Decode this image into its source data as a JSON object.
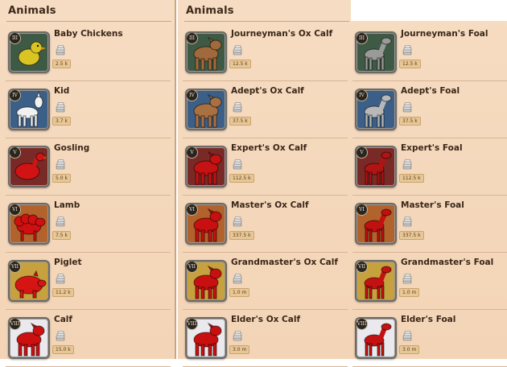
{
  "panels": [
    {
      "title": "Animals"
    },
    {
      "title": "Animals"
    }
  ],
  "left_items": [
    {
      "tier": "III",
      "name": "Baby Chickens",
      "price": "2.5 k",
      "icon": "chicken-icon",
      "bg": "#3f5a44",
      "animal": "#d9c423"
    },
    {
      "tier": "IV",
      "name": "Kid",
      "price": "3.7 k",
      "icon": "goat-kid-icon",
      "bg": "#3b5f86",
      "animal": "#f1f1f1"
    },
    {
      "tier": "V",
      "name": "Gosling",
      "price": "5.0 k",
      "icon": "gosling-icon",
      "bg": "#7a2a26",
      "animal": "#d21313"
    },
    {
      "tier": "VI",
      "name": "Lamb",
      "price": "7.5 k",
      "icon": "lamb-icon",
      "bg": "#b2622b",
      "animal": "#d01010"
    },
    {
      "tier": "VII",
      "name": "Piglet",
      "price": "11.2 k",
      "icon": "piglet-icon",
      "bg": "#c7a13d",
      "animal": "#d61414"
    },
    {
      "tier": "VIII",
      "name": "Calf",
      "price": "15.0 k",
      "icon": "calf-icon",
      "bg": "#e9e9ee",
      "animal": "#cc1010"
    }
  ],
  "right_items": [
    {
      "tier": "III",
      "name": "Journeyman's Ox Calf",
      "price": "12.5 k",
      "icon": "ox-calf-icon",
      "bg": "#3f5a44",
      "animal": "#a06a3c"
    },
    {
      "tier": "III",
      "name": "Journeyman's Foal",
      "price": "12.5 k",
      "icon": "foal-icon",
      "bg": "#3f5a44",
      "animal": "#9a9a98"
    },
    {
      "tier": "IV",
      "name": "Adept's Ox Calf",
      "price": "37.5 k",
      "icon": "ox-calf-icon",
      "bg": "#3b5f86",
      "animal": "#a97042"
    },
    {
      "tier": "IV",
      "name": "Adept's Foal",
      "price": "37.5 k",
      "icon": "foal-icon",
      "bg": "#3b5f86",
      "animal": "#b8b8b8"
    },
    {
      "tier": "V",
      "name": "Expert's Ox Calf",
      "price": "112.5 k",
      "icon": "ox-calf-icon",
      "bg": "#7a2a26",
      "animal": "#c51212"
    },
    {
      "tier": "V",
      "name": "Expert's Foal",
      "price": "112.5 k",
      "icon": "foal-icon",
      "bg": "#7a2a26",
      "animal": "#b01414"
    },
    {
      "tier": "VI",
      "name": "Master's Ox Calf",
      "price": "337.5 k",
      "icon": "ox-calf-icon",
      "bg": "#b2622b",
      "animal": "#c81010"
    },
    {
      "tier": "VI",
      "name": "Master's Foal",
      "price": "337.5 k",
      "icon": "foal-icon",
      "bg": "#b2622b",
      "animal": "#c01010"
    },
    {
      "tier": "VII",
      "name": "Grandmaster's Ox Calf",
      "price": "1.0 m",
      "icon": "ox-calf-icon",
      "bg": "#c7a13d",
      "animal": "#c91010"
    },
    {
      "tier": "VII",
      "name": "Grandmaster's Foal",
      "price": "1.0 m",
      "icon": "foal-icon",
      "bg": "#c7a13d",
      "animal": "#c41212"
    },
    {
      "tier": "VIII",
      "name": "Elder's Ox Calf",
      "price": "3.0 m",
      "icon": "ox-calf-icon",
      "bg": "#e9e9ee",
      "animal": "#c91010"
    },
    {
      "tier": "VIII",
      "name": "Elder's Foal",
      "price": "3.0 m",
      "icon": "foal-icon",
      "bg": "#e9e9ee",
      "animal": "#c41212"
    }
  ],
  "icons": {
    "currency": "silver-coins-icon"
  }
}
